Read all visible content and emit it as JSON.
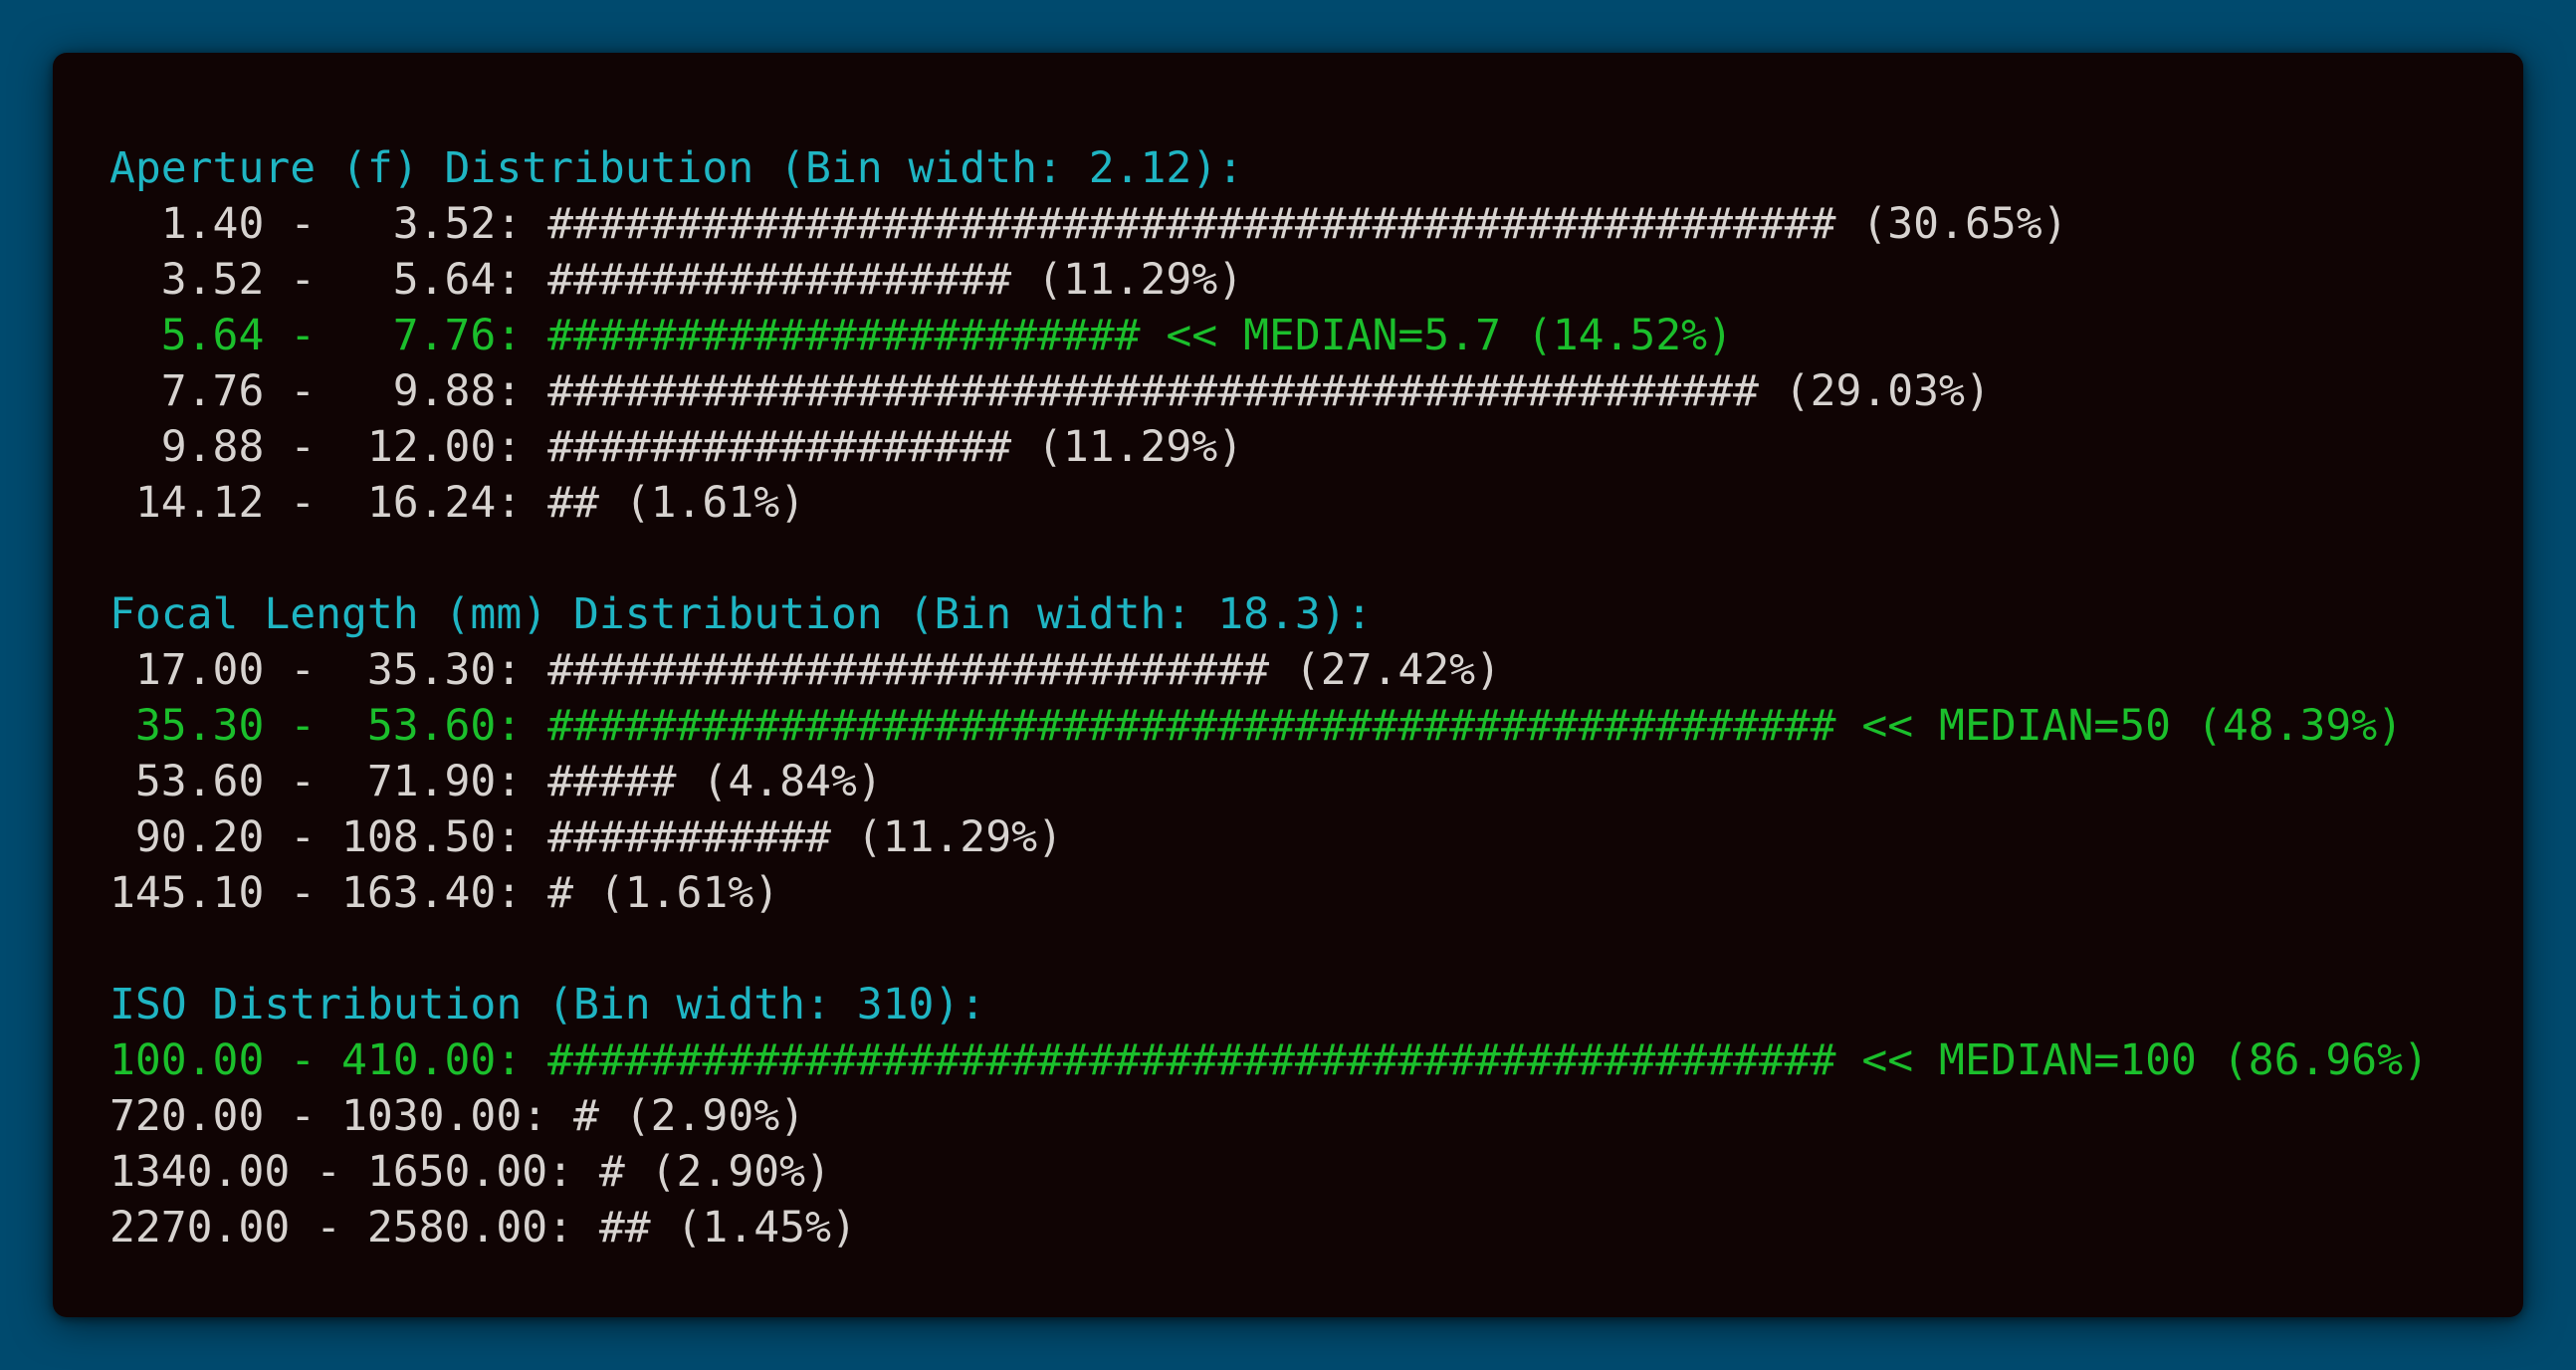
{
  "colors": {
    "background": "#004a6e",
    "terminal_bg": "#100404",
    "text": "#d7d3d0",
    "heading": "#1fb5c3",
    "median": "#1bbf2c"
  },
  "sections": [
    {
      "heading": "Aperture (f) Distribution (Bin width: 2.12):",
      "rows": [
        {
          "text": "  1.40 -   3.52: ################################################## (30.65%)",
          "median": false
        },
        {
          "text": "  3.52 -   5.64: ################## (11.29%)",
          "median": false
        },
        {
          "text": "  5.64 -   7.76: ####################### << MEDIAN=5.7 (14.52%)",
          "median": true
        },
        {
          "text": "  7.76 -   9.88: ############################################### (29.03%)",
          "median": false
        },
        {
          "text": "  9.88 -  12.00: ################## (11.29%)",
          "median": false
        },
        {
          "text": " 14.12 -  16.24: ## (1.61%)",
          "median": false
        }
      ]
    },
    {
      "heading": "Focal Length (mm) Distribution (Bin width: 18.3):",
      "rows": [
        {
          "text": " 17.00 -  35.30: ############################ (27.42%)",
          "median": false
        },
        {
          "text": " 35.30 -  53.60: ################################################## << MEDIAN=50 (48.39%)",
          "median": true
        },
        {
          "text": " 53.60 -  71.90: ##### (4.84%)",
          "median": false
        },
        {
          "text": " 90.20 - 108.50: ########### (11.29%)",
          "median": false
        },
        {
          "text": "145.10 - 163.40: # (1.61%)",
          "median": false
        }
      ]
    },
    {
      "heading": "ISO Distribution (Bin width: 310):",
      "rows": [
        {
          "text": "100.00 - 410.00: ################################################## << MEDIAN=100 (86.96%)",
          "median": true
        },
        {
          "text": "720.00 - 1030.00: # (2.90%)",
          "median": false
        },
        {
          "text": "1340.00 - 1650.00: # (2.90%)",
          "median": false
        },
        {
          "text": "2270.00 - 2580.00: ## (1.45%)",
          "median": false
        }
      ]
    }
  ]
}
